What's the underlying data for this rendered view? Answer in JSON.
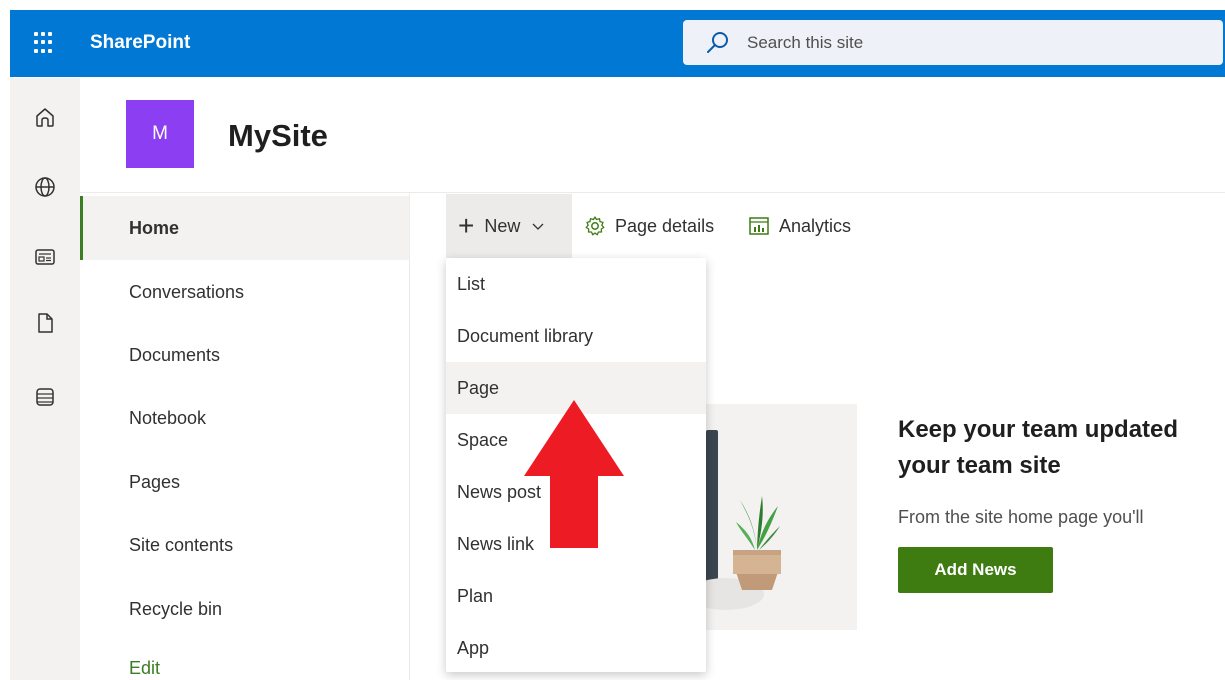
{
  "app": {
    "title": "SharePoint"
  },
  "search": {
    "placeholder": "Search this site"
  },
  "site": {
    "logo_letter": "M",
    "name": "MySite"
  },
  "nav": {
    "items": [
      {
        "label": "Home",
        "active": true
      },
      {
        "label": "Conversations"
      },
      {
        "label": "Documents"
      },
      {
        "label": "Notebook"
      },
      {
        "label": "Pages"
      },
      {
        "label": "Site contents"
      },
      {
        "label": "Recycle bin"
      }
    ],
    "edit_label": "Edit"
  },
  "commands": {
    "new_label": "New",
    "page_details_label": "Page details",
    "analytics_label": "Analytics"
  },
  "new_menu": {
    "items": [
      "List",
      "Document library",
      "Page",
      "Space",
      "News post",
      "News link",
      "Plan",
      "App"
    ],
    "highlighted": "Page"
  },
  "news": {
    "title_line1": "Keep your team updated",
    "title_line2": "your team site",
    "description": "From the site home page you'll",
    "button_label": "Add News"
  },
  "colors": {
    "suite_bar": "#0078d4",
    "site_logo": "#8b3ef2",
    "accent_green": "#3e7c12",
    "annotation_arrow": "#ed1c24"
  },
  "icons": {
    "rail": [
      "home-icon",
      "globe-icon",
      "news-feed-icon",
      "document-icon",
      "lists-icon"
    ]
  }
}
